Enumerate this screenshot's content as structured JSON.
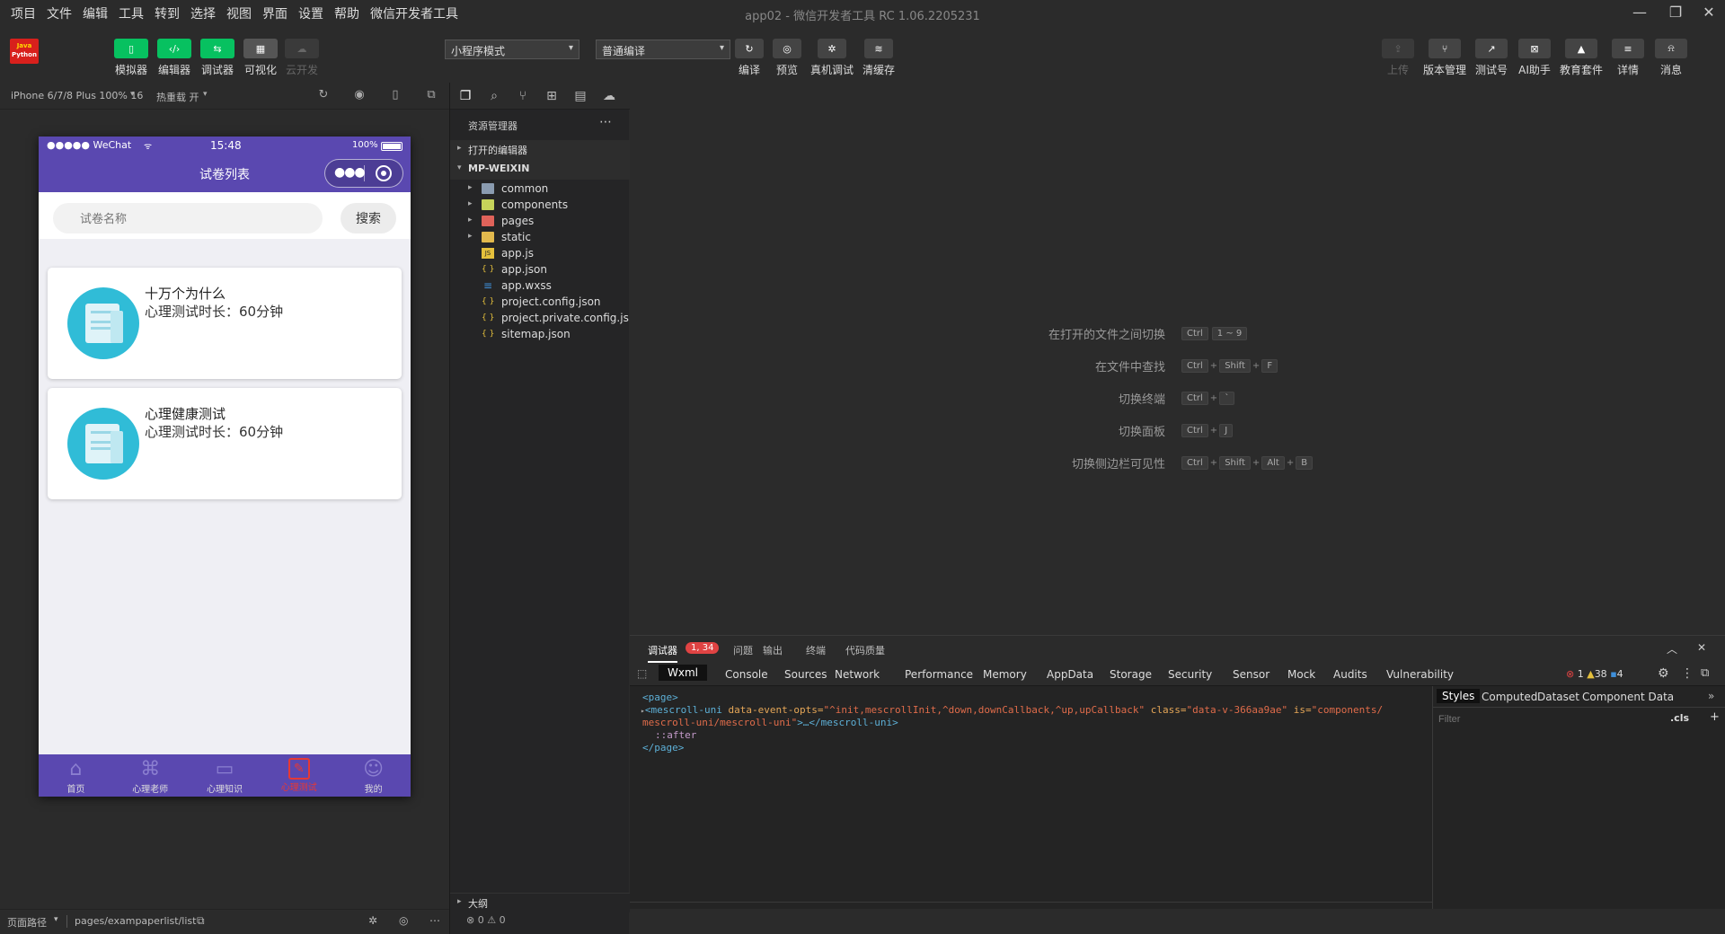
{
  "menu": [
    "项目",
    "文件",
    "编辑",
    "工具",
    "转到",
    "选择",
    "视图",
    "界面",
    "设置",
    "帮助",
    "微信开发者工具"
  ],
  "window_title": "app02 - 微信开发者工具 RC 1.06.2205231",
  "logo_text": [
    "Java",
    "Python"
  ],
  "toolbar": {
    "left": [
      {
        "label": "模拟器",
        "icon": "phone-icon",
        "style": "green"
      },
      {
        "label": "编辑器",
        "icon": "code-icon",
        "style": "green"
      },
      {
        "label": "调试器",
        "icon": "debug-icon",
        "style": "green"
      },
      {
        "label": "可视化",
        "icon": "layout-icon",
        "style": "gray"
      },
      {
        "label": "云开发",
        "icon": "cloud-icon",
        "style": "disabled"
      }
    ],
    "mode_select": "小程序模式",
    "compile_select": "普通编译",
    "middle": [
      {
        "label": "编译",
        "icon": "refresh-icon"
      },
      {
        "label": "预览",
        "icon": "eye-icon"
      },
      {
        "label": "真机调试",
        "icon": "bug-icon"
      },
      {
        "label": "清缓存",
        "icon": "layers-icon"
      }
    ],
    "right": [
      {
        "label": "上传",
        "icon": "upload-icon"
      },
      {
        "label": "版本管理",
        "icon": "branch-icon"
      },
      {
        "label": "测试号",
        "icon": "external-icon"
      },
      {
        "label": "AI助手",
        "icon": "ai-icon"
      },
      {
        "label": "教育套件",
        "icon": "graduation-icon"
      },
      {
        "label": "详情",
        "icon": "menu-icon"
      },
      {
        "label": "消息",
        "icon": "bell-icon"
      }
    ]
  },
  "simulator": {
    "device": "iPhone 6/7/8 Plus 100% 16",
    "hot_reload": "热重载 开",
    "status_carrier": "●●●●● WeChat",
    "status_time": "15:48",
    "status_battery": "100%",
    "nav_title": "试卷列表",
    "search_placeholder": "试卷名称",
    "search_button": "搜索",
    "cards": [
      {
        "title": "十万个为什么",
        "subtitle": "心理测试时长：60分钟"
      },
      {
        "title": "心理健康测试",
        "subtitle": "心理测试时长：60分钟"
      }
    ],
    "tabs": [
      {
        "label": "首页",
        "icon": "home-icon",
        "active": false
      },
      {
        "label": "心理老师",
        "icon": "grid-icon",
        "active": false
      },
      {
        "label": "心理知识",
        "icon": "book-icon",
        "active": false
      },
      {
        "label": "心理测试",
        "icon": "test-icon",
        "active": true
      },
      {
        "label": "我的",
        "icon": "user-icon",
        "active": false
      }
    ],
    "path_label": "页面路径",
    "path_value": "pages/exampaperlist/list"
  },
  "explorer": {
    "title": "资源管理器",
    "open_editors": "打开的编辑器",
    "root": "MP-WEIXIN",
    "items": [
      {
        "name": "common",
        "type": "folder",
        "color": "#8a9bb0",
        "icon": "folder-icon"
      },
      {
        "name": "components",
        "type": "folder",
        "color": "#c6d35a",
        "icon": "folder-icon"
      },
      {
        "name": "pages",
        "type": "folder",
        "color": "#e0635a",
        "icon": "folder-icon"
      },
      {
        "name": "static",
        "type": "folder",
        "color": "#e2b94d",
        "icon": "folder-icon"
      },
      {
        "name": "app.js",
        "type": "file",
        "color": "#e5c03c",
        "icon": "js-file-icon"
      },
      {
        "name": "app.json",
        "type": "file",
        "color": "#e5c03c",
        "icon": "json-file-icon"
      },
      {
        "name": "app.wxss",
        "type": "file",
        "color": "#3f8fd9",
        "icon": "css-file-icon"
      },
      {
        "name": "project.config.json",
        "type": "file",
        "color": "#e5c03c",
        "icon": "json-file-icon"
      },
      {
        "name": "project.private.config.js...",
        "type": "file",
        "color": "#e5c03c",
        "icon": "json-file-icon"
      },
      {
        "name": "sitemap.json",
        "type": "file",
        "color": "#e5c03c",
        "icon": "json-file-icon"
      }
    ],
    "outline": "大纲",
    "problems": "⊗ 0 ⚠ 0"
  },
  "shortcuts": [
    {
      "label": "在打开的文件之间切换",
      "keys": [
        "Ctrl",
        "1 ~ 9"
      ],
      "sep": [
        ""
      ]
    },
    {
      "label": "在文件中查找",
      "keys": [
        "Ctrl",
        "Shift",
        "F"
      ]
    },
    {
      "label": "切换终端",
      "keys": [
        "Ctrl",
        "`"
      ]
    },
    {
      "label": "切换面板",
      "keys": [
        "Ctrl",
        "J"
      ]
    },
    {
      "label": "切换侧边栏可见性",
      "keys": [
        "Ctrl",
        "Shift",
        "Alt",
        "B"
      ]
    }
  ],
  "devtools": {
    "top_tabs": [
      "调试器",
      "问题",
      "输出",
      "终端",
      "代码质量"
    ],
    "badge": "1, 34",
    "tabs": [
      "Wxml",
      "Console",
      "Sources",
      "Network",
      "Performance",
      "Memory",
      "AppData",
      "Storage",
      "Security",
      "Sensor",
      "Mock",
      "Audits",
      "Vulnerability"
    ],
    "counts": {
      "errors": "1",
      "warnings": "38",
      "info": "4"
    },
    "wxml": {
      "line1": "<page>",
      "line2_tag": "<mescroll-uni",
      "line2_attr": " data-event-opts=",
      "line2_val": "\"^init,mescrollInit,^down,downCallback,^up,upCallback\"",
      "line2_class": " class=",
      "line2_classval": "\"data-v-366aa9ae\"",
      "line2_is": " is=",
      "line2_isval": "\"components/",
      "line3": "mescroll-uni/mescroll-uni\"",
      "line3_tail": ">…</mescroll-uni>",
      "line4": "::after",
      "line5": "</page>"
    },
    "style_tabs": [
      "Styles",
      "Computed",
      "Dataset",
      "Component Data"
    ],
    "filter_placeholder": "Filter",
    "cls": ".cls",
    "plus": "+"
  }
}
